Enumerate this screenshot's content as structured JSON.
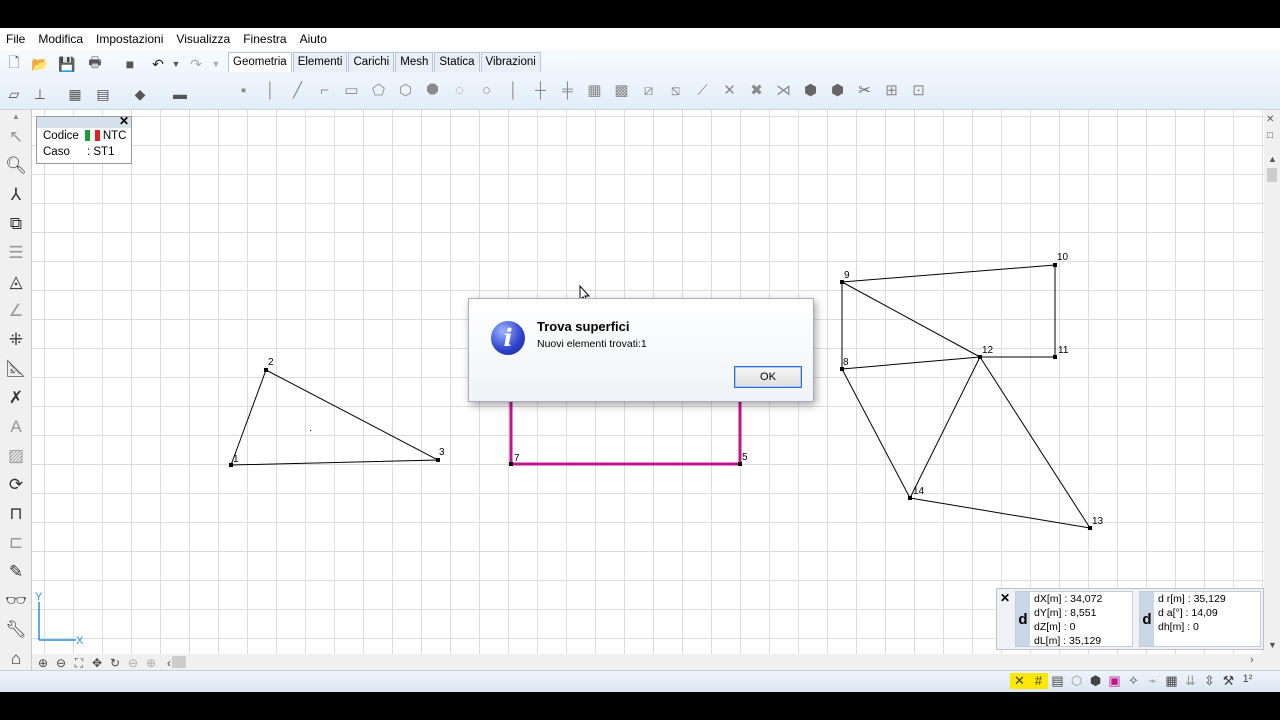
{
  "menu": [
    "File",
    "Modifica",
    "Impostazioni",
    "Visualizza",
    "Finestra",
    "Aiuto"
  ],
  "tabs": [
    "Geometria",
    "Elementi",
    "Carichi",
    "Mesh",
    "Statica",
    "Vibrazioni"
  ],
  "info_box": {
    "codice_label": "Codice",
    "codice_value": "NTC",
    "caso_label": "Caso",
    "caso_value": ": ST1"
  },
  "dialog": {
    "title": "Trova superfici",
    "message": "Nuovi elementi trovati:1",
    "ok_label": "OK"
  },
  "nodes": {
    "n1": "1",
    "n2": "2",
    "n3": "3",
    "n5": "5",
    "n7": "7",
    "n8": "8",
    "n9": "9",
    "n10": "10",
    "n11": "11",
    "n12": "12",
    "n13": "13",
    "n14": "14"
  },
  "axes": {
    "x": "X",
    "y": "Y"
  },
  "measure": {
    "dx": "dX[m] : 34,072",
    "dy": "dY[m] : 8,551",
    "dz": "dZ[m] : 0",
    "dl": "dL[m] : 35,129",
    "dr": "d r[m] : 35,129",
    "da": "d a[°] : 14,09",
    "dh": "dh[m] : 0",
    "d1": "d",
    "d2": "d"
  },
  "status_right": "1²",
  "colors": {
    "selection": "#c0148c",
    "dialog_border": "#2a6fd1"
  }
}
